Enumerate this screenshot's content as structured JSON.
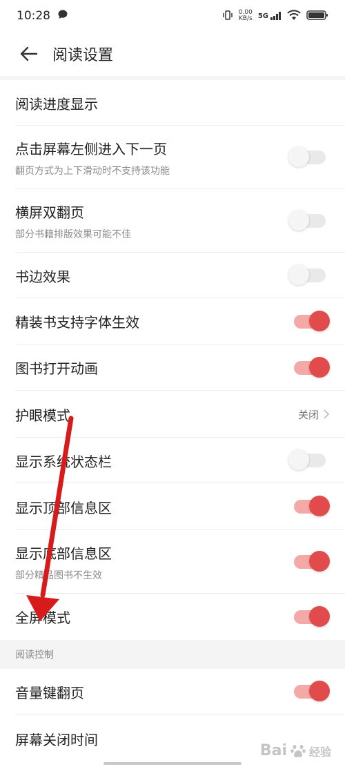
{
  "status_bar": {
    "time": "10:28",
    "net_speed_value": "0.00",
    "net_speed_unit": "KB/s",
    "network_type": "5G",
    "icons": [
      "chat-bubble-icon",
      "vibrate-icon",
      "signal-icon",
      "wifi-icon",
      "battery-icon"
    ]
  },
  "header": {
    "back_icon": "back-arrow-icon",
    "title": "阅读设置"
  },
  "settings": [
    {
      "label": "阅读进度显示",
      "sub": "",
      "control": "none"
    },
    {
      "label": "点击屏幕左侧进入下一页",
      "sub": "翻页方式为上下滑动时不支持该功能",
      "control": "toggle",
      "on": false
    },
    {
      "label": "横屏双翻页",
      "sub": "部分书籍排版效果可能不佳",
      "control": "toggle",
      "on": false
    },
    {
      "label": "书边效果",
      "sub": "",
      "control": "toggle",
      "on": false
    },
    {
      "label": "精装书支持字体生效",
      "sub": "",
      "control": "toggle",
      "on": true
    },
    {
      "label": "图书打开动画",
      "sub": "",
      "control": "toggle",
      "on": true
    },
    {
      "label": "护眼模式",
      "sub": "",
      "control": "value",
      "value": "关闭"
    },
    {
      "label": "显示系统状态栏",
      "sub": "",
      "control": "toggle",
      "on": false
    },
    {
      "label": "显示顶部信息区",
      "sub": "",
      "control": "toggle",
      "on": true
    },
    {
      "label": "显示底部信息区",
      "sub": "部分精品图书不生效",
      "control": "toggle",
      "on": true
    },
    {
      "label": "全屏模式",
      "sub": "",
      "control": "toggle",
      "on": true
    }
  ],
  "section_reading_control": {
    "title": "阅读控制"
  },
  "settings_control": [
    {
      "label": "音量键翻页",
      "sub": "",
      "control": "toggle",
      "on": true
    },
    {
      "label": "屏幕关闭时间",
      "sub": "",
      "control": "none"
    }
  ],
  "watermark": {
    "brand": "Bai",
    "suffix": "经验"
  },
  "colors": {
    "accent": "#e14b4b",
    "accent_track": "#f3a9a6",
    "annotation_arrow": "#d71b1b"
  }
}
